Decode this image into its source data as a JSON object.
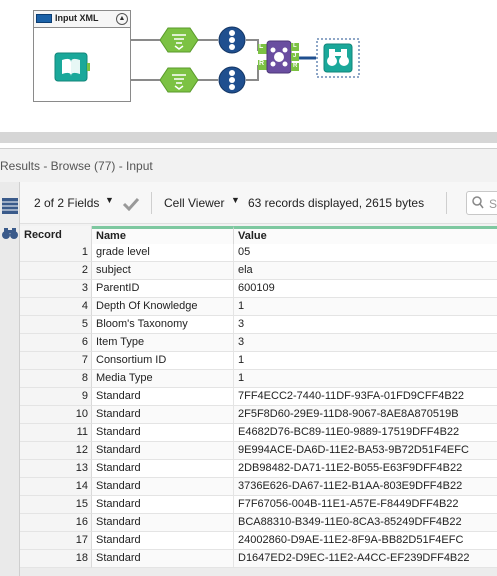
{
  "workflow": {
    "container_title": "Input XML",
    "collapse_glyph": "▲",
    "anchor_labels": {
      "join_left": "L",
      "join_right": "R",
      "join_j": "J",
      "join_out_l": "L",
      "join_out_r": "R"
    },
    "icons": [
      "book-input-icon",
      "xml-parse-icon",
      "record-id-icon",
      "join-icon",
      "browse-binoculars-icon"
    ]
  },
  "results": {
    "title": "Results - Browse (77) - Input",
    "fields_selector": "2 of 2 Fields",
    "cell_viewer": "Cell Viewer",
    "records_info": "63 records displayed, 2615 bytes",
    "search_placeholder": "Se",
    "columns": [
      "Record",
      "Name",
      "Value"
    ],
    "rows": [
      {
        "record": "1",
        "name": "grade level",
        "value": "05"
      },
      {
        "record": "2",
        "name": "subject",
        "value": "ela"
      },
      {
        "record": "3",
        "name": "ParentID",
        "value": "600109"
      },
      {
        "record": "4",
        "name": "Depth Of Knowledge",
        "value": "1"
      },
      {
        "record": "5",
        "name": "Bloom's Taxonomy",
        "value": "3"
      },
      {
        "record": "6",
        "name": "Item Type",
        "value": "3"
      },
      {
        "record": "7",
        "name": "Consortium ID",
        "value": "1"
      },
      {
        "record": "8",
        "name": "Media Type",
        "value": "1"
      },
      {
        "record": "9",
        "name": "Standard",
        "value": "7FF4ECC2-7440-11DF-93FA-01FD9CFF4B22"
      },
      {
        "record": "10",
        "name": "Standard",
        "value": "2F5F8D60-29E9-11D8-9067-8AE8A870519B"
      },
      {
        "record": "11",
        "name": "Standard",
        "value": "E4682D76-BC89-11E0-9889-17519DFF4B22"
      },
      {
        "record": "12",
        "name": "Standard",
        "value": "9E994ACE-DA6D-11E2-BA53-9B72D51F4EFC"
      },
      {
        "record": "13",
        "name": "Standard",
        "value": "2DB98482-DA71-11E2-B055-E63F9DFF4B22"
      },
      {
        "record": "14",
        "name": "Standard",
        "value": "3736E626-DA67-11E2-B1AA-803E9DFF4B22"
      },
      {
        "record": "15",
        "name": "Standard",
        "value": "F7F67056-004B-11E1-A57E-F8449DFF4B22"
      },
      {
        "record": "16",
        "name": "Standard",
        "value": "BCA88310-B349-11E0-8CA3-85249DFF4B22"
      },
      {
        "record": "17",
        "name": "Standard",
        "value": "24002860-D9AE-11E2-8F9A-BB82D51F4EFC"
      },
      {
        "record": "18",
        "name": "Standard",
        "value": "D1647ED2-D9EC-11E2-A4CC-EF239DFF4B22"
      }
    ]
  },
  "colors": {
    "tool_green": "#7cc243",
    "tool_blue": "#1f4f8f",
    "join_purple": "#6a4ea0",
    "browse_teal": "#1aa89a",
    "header_accent": "#7ec8a0"
  }
}
